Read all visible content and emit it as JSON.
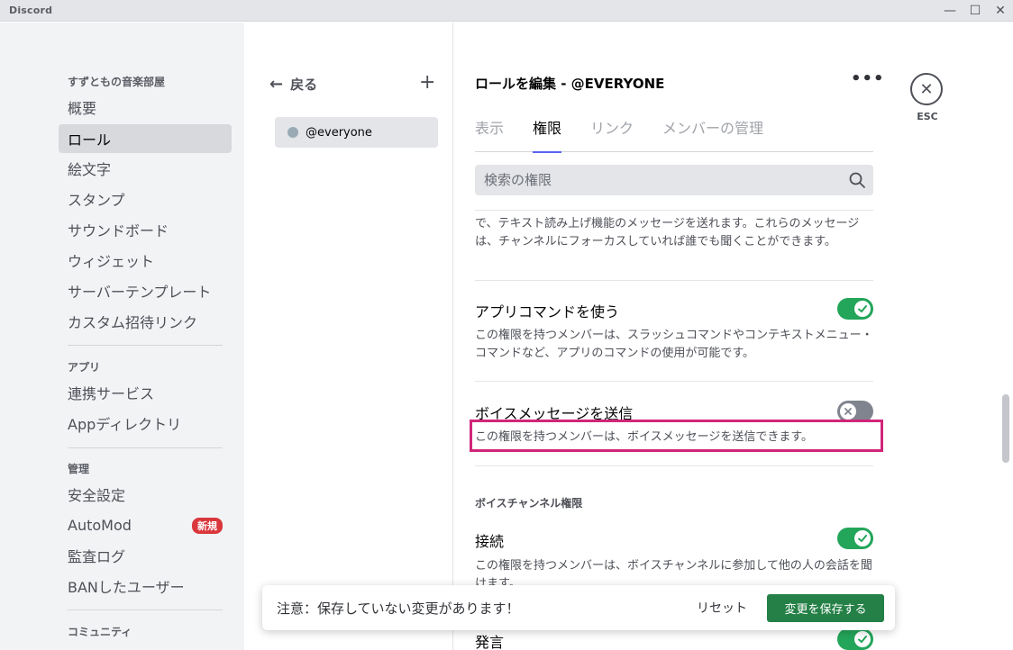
{
  "window": {
    "title": "Discord"
  },
  "sidebar": {
    "server_name": "すずともの音楽部屋",
    "server_items": [
      {
        "label": "概要"
      },
      {
        "label": "ロール"
      },
      {
        "label": "絵文字"
      },
      {
        "label": "スタンプ"
      },
      {
        "label": "サウンドボード"
      },
      {
        "label": "ウィジェット"
      },
      {
        "label": "サーバーテンプレート"
      },
      {
        "label": "カスタム招待リンク"
      }
    ],
    "apps_header": "アプリ",
    "apps_items": [
      {
        "label": "連携サービス"
      },
      {
        "label": "Appディレクトリ"
      }
    ],
    "manage_header": "管理",
    "manage_items": [
      {
        "label": "安全設定"
      },
      {
        "label": "AutoMod",
        "badge": "新規"
      },
      {
        "label": "監査ログ"
      },
      {
        "label": "BANしたユーザー"
      }
    ],
    "community_header": "コミュニティ"
  },
  "rolelist": {
    "back_label": "戻る",
    "add_icon": "+",
    "roles": [
      {
        "name": "@everyone",
        "color": "#99aab5"
      }
    ]
  },
  "main": {
    "title": "ロールを編集 - @EVERYONE",
    "tabs": [
      {
        "label": "表示"
      },
      {
        "label": "権限"
      },
      {
        "label": "リンク"
      },
      {
        "label": "メンバーの管理"
      }
    ],
    "active_tab": "権限",
    "search_placeholder": "検索の権限",
    "truncated_desc": "で、テキスト読み上げ機能のメッセージを送れます。これらのメッセージは、チャンネルにフォーカスしていれば誰でも聞くことができます。",
    "permissions": [
      {
        "title": "アプリコマンドを使う",
        "desc": "この権限を持つメンバーは、スラッシュコマンドやコンテキストメニュー・コマンドなど、アプリのコマンドの使用が可能です。",
        "enabled": true
      },
      {
        "title": "ボイスメッセージを送信",
        "desc": "この権限を持つメンバーは、ボイスメッセージを送信できます。",
        "enabled": false
      }
    ],
    "voice_section_header": "ボイスチャンネル権限",
    "voice_permissions": [
      {
        "title": "接続",
        "desc": "この権限を持つメンバーは、ボイスチャンネルに参加して他の人の会話を聞けます。",
        "enabled": true
      },
      {
        "title": "発言",
        "enabled": true
      }
    ]
  },
  "close": {
    "label": "ESC"
  },
  "unsaved": {
    "message": "注意：保存していない変更があります！",
    "reset_label": "リセット",
    "save_label": "変更を保存する"
  },
  "colors": {
    "accent": "#5865f2",
    "toggle_on": "#23a55a",
    "toggle_off": "#80848e",
    "highlight": "#d1267a",
    "save": "#248046"
  }
}
